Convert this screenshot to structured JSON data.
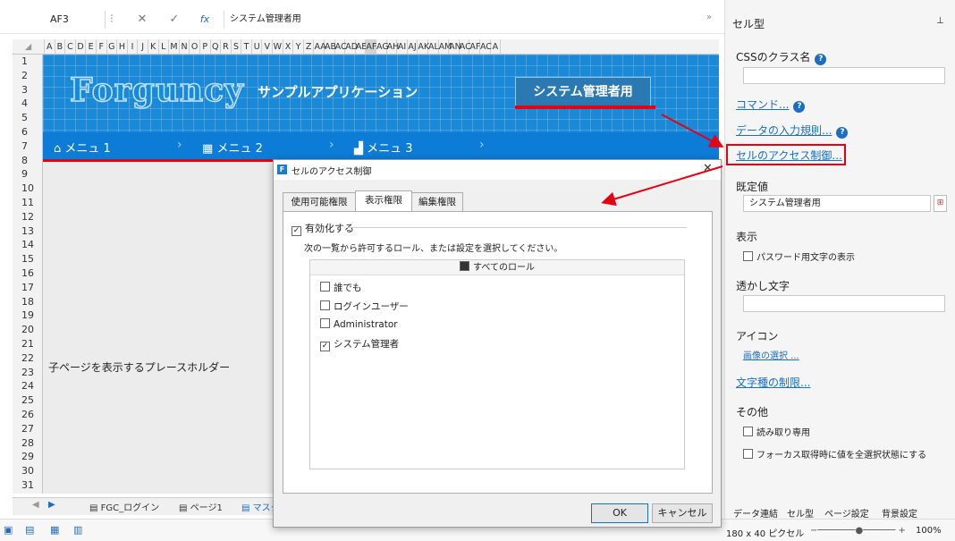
{
  "formula": {
    "cell_ref": "AF3",
    "value": "システム管理者用",
    "cancel_glyph": "✕",
    "confirm_glyph": "✓",
    "fx": "fx",
    "expand_glyph": "»"
  },
  "columns": [
    "A",
    "B",
    "C",
    "D",
    "E",
    "F",
    "G",
    "H",
    "I",
    "J",
    "K",
    "L",
    "M",
    "N",
    "O",
    "P",
    "Q",
    "R",
    "S",
    "T",
    "U",
    "V",
    "W",
    "X",
    "Y",
    "Z",
    "AA",
    "AB",
    "AC",
    "AD",
    "AE",
    "AF",
    "AG",
    "AH",
    "AI",
    "AJ",
    "AK",
    "AL",
    "AM",
    "AN",
    "AC",
    "AF",
    "AC",
    "A"
  ],
  "rows": [
    "1",
    "2",
    "3",
    "4",
    "5",
    "6",
    "7",
    "8",
    "9",
    "10",
    "11",
    "12",
    "13",
    "14",
    "15",
    "16",
    "17",
    "18",
    "19",
    "20",
    "21",
    "22",
    "23",
    "24",
    "25",
    "26",
    "27",
    "28",
    "29",
    "30",
    "31"
  ],
  "banner": {
    "logo": "Forguncy",
    "app_title": "サンプルアプリケーション",
    "admin_button": "システム管理者用"
  },
  "menu": [
    {
      "label": "メニュ 1",
      "icon": "home-icon"
    },
    {
      "label": "メニュ 2",
      "icon": "table-icon"
    },
    {
      "label": "メニュ 3",
      "icon": "chart-icon"
    }
  ],
  "placeholder_text": "子ページを表示するプレースホルダー",
  "sheet_tabs": {
    "prev": "◀",
    "next": "▶",
    "tabs": [
      "FGC_ログイン",
      "ページ1",
      "マスタ"
    ]
  },
  "dialog": {
    "title": "セルのアクセス制御",
    "close": "✕",
    "tabs": [
      "使用可能権限",
      "表示権限",
      "編集権限"
    ],
    "active_tab": "表示権限",
    "enable_label": "有効化する",
    "enable_checked": true,
    "instruction": "次の一覧から許可するロール、または設定を選択してください。",
    "list_header": "すべてのロール",
    "roles": [
      {
        "name": "誰でも",
        "checked": false
      },
      {
        "name": "ログインユーザー",
        "checked": false
      },
      {
        "name": "Administrator",
        "checked": false
      },
      {
        "name": "システム管理者",
        "checked": true
      }
    ],
    "ok": "OK",
    "cancel": "キャンセル"
  },
  "right_pane": {
    "title": "セル型",
    "pin": "📌",
    "css_class_label": "CSSのクラス名",
    "command_link": "コマンド...",
    "validation_link": "データの入力規則...",
    "access_link": "セルのアクセス制御...",
    "default_label": "既定値",
    "default_value": "システム管理者用",
    "display_label": "表示",
    "password_label": "パスワード用文字の表示",
    "watermark_label": "透かし文字",
    "icon_label": "アイコン",
    "image_link": "画像の選択 ...",
    "char_limit_link": "文字種の制限...",
    "other_label": "その他",
    "readonly_label": "読み取り専用",
    "select_all_label": "フォーカス取得時に値を全選択状態にする",
    "bottom_tabs": [
      "データ連結",
      "セル型",
      "ページ設定",
      "背景設定"
    ]
  },
  "status": {
    "cell_size": "180 x 40 ピクセル",
    "zoom": "100%"
  },
  "colors": {
    "accent": "#1a8ad8",
    "menu": "#0c7cd6",
    "highlight": "#e60012",
    "link": "#1a6fc2"
  }
}
